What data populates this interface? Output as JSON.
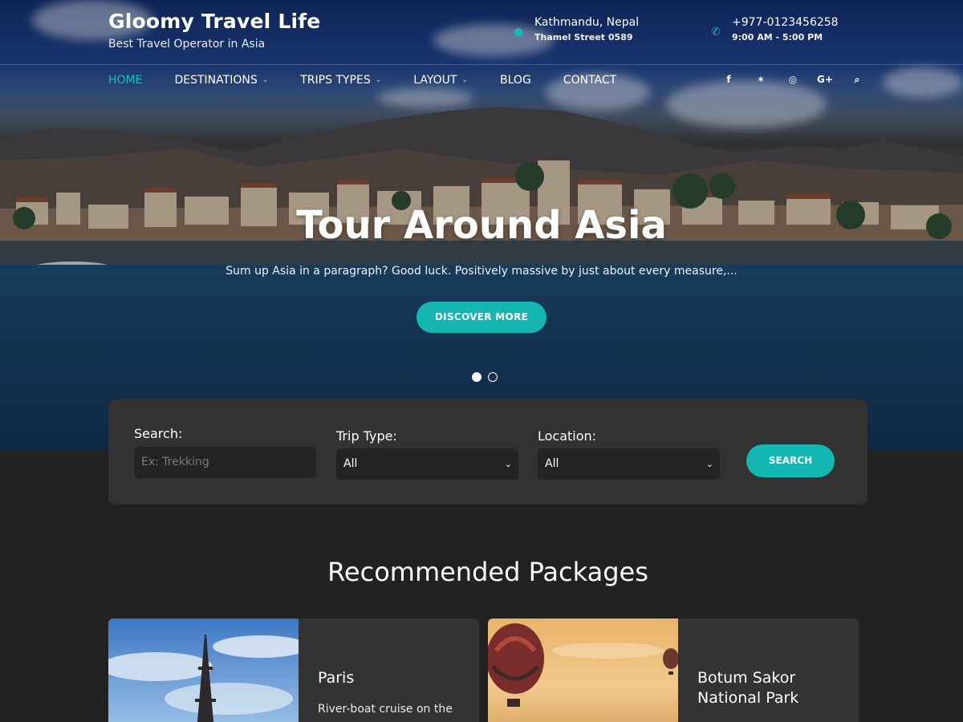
{
  "site": {
    "title": "Gloomy Travel Life",
    "tagline": "Best Travel Operator in Asia"
  },
  "contact": {
    "location": {
      "icon": "map-pin-icon",
      "main": "Kathmandu, Nepal",
      "sub": "Thamel Street 0589"
    },
    "phone": {
      "icon": "phone-icon",
      "main": "+977-0123456258",
      "sub": "9:00 AM - 5:00 PM"
    }
  },
  "nav": {
    "items": [
      {
        "label": "HOME",
        "active": true,
        "dropdown": false
      },
      {
        "label": "DESTINATIONS",
        "active": false,
        "dropdown": true
      },
      {
        "label": "TRIPS TYPES",
        "active": false,
        "dropdown": true
      },
      {
        "label": "LAYOUT",
        "active": false,
        "dropdown": true
      },
      {
        "label": "BLOG",
        "active": false,
        "dropdown": false
      },
      {
        "label": "CONTACT",
        "active": false,
        "dropdown": false
      }
    ],
    "social": [
      {
        "name": "facebook-icon",
        "glyph": "f"
      },
      {
        "name": "twitter-icon",
        "glyph": "✶"
      },
      {
        "name": "instagram-icon",
        "glyph": "◎"
      },
      {
        "name": "google-plus-icon",
        "glyph": "G+"
      },
      {
        "name": "search-icon",
        "glyph": "⌕"
      }
    ]
  },
  "hero": {
    "title": "Tour Around Asia",
    "subtitle": "Sum up Asia in a paragraph? Good luck. Positively massive by just about every measure,...",
    "button": "DISCOVER MORE",
    "slides": 2,
    "active_slide": 1
  },
  "search": {
    "search_label": "Search:",
    "search_placeholder": "Ex: Trekking",
    "trip_type_label": "Trip Type:",
    "trip_type_value": "All",
    "location_label": "Location:",
    "location_value": "All",
    "button": "SEARCH"
  },
  "recommended": {
    "title": "Recommended Packages",
    "packages": [
      {
        "title": "Paris",
        "description": "River-boat cruise on the",
        "image": "eiffel-tower"
      },
      {
        "title": "Botum Sakor National Park",
        "description": "",
        "image": "hot-air-balloons"
      }
    ]
  },
  "colors": {
    "accent": "#14b6b1",
    "background": "#222222",
    "panel": "#323232",
    "card": "#333333"
  }
}
